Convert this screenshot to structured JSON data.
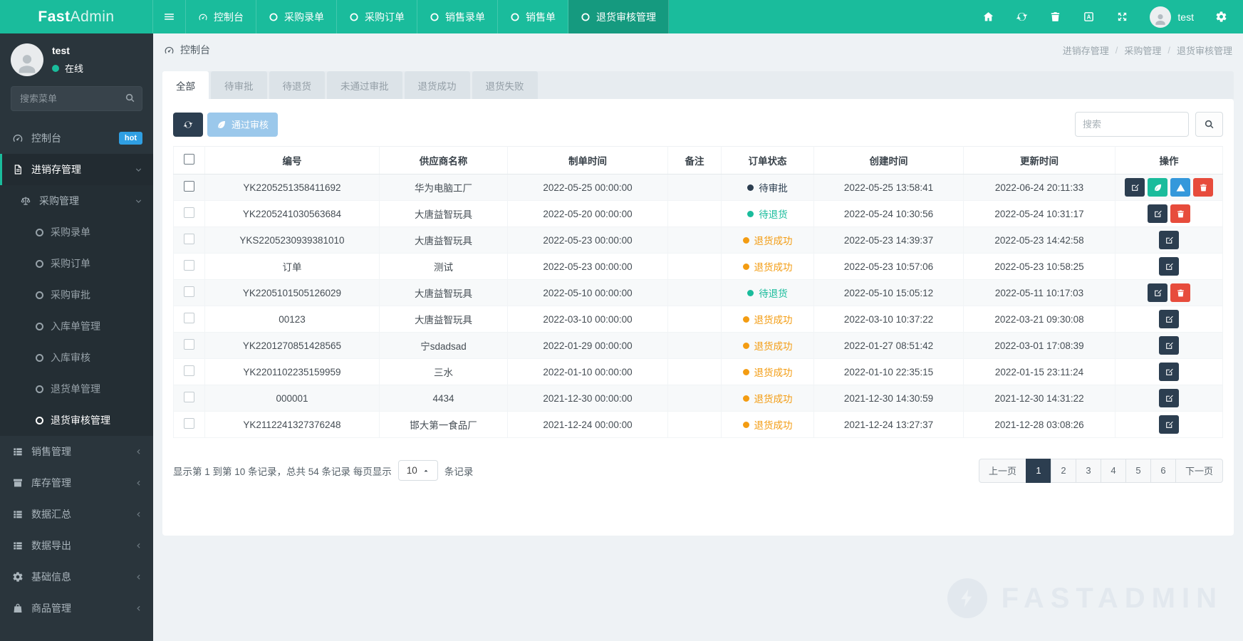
{
  "brand": {
    "bold": "Fast",
    "light": "Admin"
  },
  "colors": {
    "accent": "#1abc9c",
    "dark": "#2c3e50",
    "info": "#3498db",
    "danger": "#e74c3c",
    "warning": "#f39c12",
    "badge": "#2f9fe3"
  },
  "topnav": {
    "items": [
      {
        "key": "console",
        "label": "控制台",
        "icon": "gauge",
        "active": false
      },
      {
        "key": "purchase-entry",
        "label": "采购录单",
        "icon": "circle-o",
        "active": false
      },
      {
        "key": "purchase-order",
        "label": "采购订单",
        "icon": "circle-o",
        "active": false
      },
      {
        "key": "sale-entry",
        "label": "销售录单",
        "icon": "circle-o",
        "active": false
      },
      {
        "key": "sale-order",
        "label": "销售单",
        "icon": "circle-o",
        "active": false
      },
      {
        "key": "return-audit",
        "label": "退货审核管理",
        "icon": "circle-o",
        "active": true
      }
    ],
    "right_icons": [
      {
        "key": "home",
        "icon": "home"
      },
      {
        "key": "refresh",
        "icon": "refresh"
      },
      {
        "key": "trash",
        "icon": "trash"
      },
      {
        "key": "language",
        "icon": "language"
      },
      {
        "key": "fullscreen",
        "icon": "expand"
      }
    ],
    "user": {
      "name": "test"
    }
  },
  "sidebar": {
    "user": {
      "name": "test",
      "status": "在线"
    },
    "search_placeholder": "搜索菜单",
    "menu": [
      {
        "key": "console",
        "label": "控制台",
        "icon": "gauge",
        "badge": "hot"
      },
      {
        "key": "jxc",
        "label": "进销存管理",
        "icon": "file-text",
        "chevron": "down",
        "active": true,
        "children": [
          {
            "key": "purchase",
            "label": "采购管理",
            "icon": "scale",
            "chevron": "down",
            "children": [
              {
                "key": "purchase-entry",
                "label": "采购录单"
              },
              {
                "key": "purchase-order",
                "label": "采购订单"
              },
              {
                "key": "purchase-approve",
                "label": "采购审批"
              },
              {
                "key": "stockin-manage",
                "label": "入库单管理"
              },
              {
                "key": "stockin-audit",
                "label": "入库审核"
              },
              {
                "key": "return-manage",
                "label": "退货单管理"
              },
              {
                "key": "return-audit",
                "label": "退货审核管理",
                "active": true
              }
            ]
          }
        ]
      },
      {
        "key": "sale",
        "label": "销售管理",
        "icon": "list",
        "chevron": "left"
      },
      {
        "key": "stock",
        "label": "库存管理",
        "icon": "archive",
        "chevron": "left"
      },
      {
        "key": "data-summary",
        "label": "数据汇总",
        "icon": "list",
        "chevron": "left"
      },
      {
        "key": "data-export",
        "label": "数据导出",
        "icon": "list",
        "chevron": "left"
      },
      {
        "key": "base-info",
        "label": "基础信息",
        "icon": "cogs",
        "chevron": "left"
      },
      {
        "key": "goods",
        "label": "商品管理",
        "icon": "bag",
        "chevron": "left"
      }
    ]
  },
  "header": {
    "title": "控制台",
    "breadcrumb": [
      "进销存管理",
      "采购管理",
      "退货审核管理"
    ]
  },
  "tabs": [
    {
      "label": "全部",
      "active": true
    },
    {
      "label": "待审批",
      "active": false
    },
    {
      "label": "待退货",
      "active": false
    },
    {
      "label": "未通过审批",
      "active": false
    },
    {
      "label": "退货成功",
      "active": false
    },
    {
      "label": "退货失败",
      "active": false
    }
  ],
  "toolbar": {
    "approve_label": "通过审核",
    "search_placeholder": "搜索"
  },
  "table": {
    "columns": [
      "编号",
      "供应商名称",
      "制单时间",
      "备注",
      "订单状态",
      "创建时间",
      "更新时间",
      "操作"
    ],
    "action_styles": {
      "edit": {
        "icon": "edit",
        "color": "#2c3e50"
      },
      "leaf": {
        "icon": "leaf",
        "color": "#1abc9c"
      },
      "warn": {
        "icon": "warn",
        "color": "#3498db"
      },
      "trash": {
        "icon": "trash",
        "color": "#e74c3c"
      }
    },
    "rows": [
      {
        "id": "YK2205251358411692",
        "supplier": "华为电脑工厂",
        "order_time": "2022-05-25 00:00:00",
        "remark": "",
        "status": {
          "label": "待审批",
          "color": "#2c3e50"
        },
        "created": "2022-05-25 13:58:41",
        "updated": "2022-06-24 20:11:33",
        "actions": [
          "edit",
          "leaf",
          "warn",
          "trash"
        ]
      },
      {
        "id": "YK2205241030563684",
        "supplier": "大唐益智玩具",
        "order_time": "2022-05-20 00:00:00",
        "remark": "",
        "status": {
          "label": "待退货",
          "color": "#1abc9c"
        },
        "created": "2022-05-24 10:30:56",
        "updated": "2022-05-24 10:31:17",
        "actions": [
          "edit",
          "trash"
        ]
      },
      {
        "id": "YKS2205230939381010",
        "supplier": "大唐益智玩具",
        "order_time": "2022-05-23 00:00:00",
        "remark": "",
        "status": {
          "label": "退货成功",
          "color": "#f39c12"
        },
        "created": "2022-05-23 14:39:37",
        "updated": "2022-05-23 14:42:58",
        "actions": [
          "edit"
        ]
      },
      {
        "id": "订单",
        "supplier": "测试",
        "order_time": "2022-05-23 00:00:00",
        "remark": "",
        "status": {
          "label": "退货成功",
          "color": "#f39c12"
        },
        "created": "2022-05-23 10:57:06",
        "updated": "2022-05-23 10:58:25",
        "actions": [
          "edit"
        ]
      },
      {
        "id": "YK2205101505126029",
        "supplier": "大唐益智玩具",
        "order_time": "2022-05-10 00:00:00",
        "remark": "",
        "status": {
          "label": "待退货",
          "color": "#1abc9c"
        },
        "created": "2022-05-10 15:05:12",
        "updated": "2022-05-11 10:17:03",
        "actions": [
          "edit",
          "trash"
        ]
      },
      {
        "id": "00123",
        "supplier": "大唐益智玩具",
        "order_time": "2022-03-10 00:00:00",
        "remark": "",
        "status": {
          "label": "退货成功",
          "color": "#f39c12"
        },
        "created": "2022-03-10 10:37:22",
        "updated": "2022-03-21 09:30:08",
        "actions": [
          "edit"
        ]
      },
      {
        "id": "YK2201270851428565",
        "supplier": "宁sdadsad",
        "order_time": "2022-01-29 00:00:00",
        "remark": "",
        "status": {
          "label": "退货成功",
          "color": "#f39c12"
        },
        "created": "2022-01-27 08:51:42",
        "updated": "2022-03-01 17:08:39",
        "actions": [
          "edit"
        ]
      },
      {
        "id": "YK2201102235159959",
        "supplier": "三水",
        "order_time": "2022-01-10 00:00:00",
        "remark": "",
        "status": {
          "label": "退货成功",
          "color": "#f39c12"
        },
        "created": "2022-01-10 22:35:15",
        "updated": "2022-01-15 23:11:24",
        "actions": [
          "edit"
        ]
      },
      {
        "id": "000001",
        "supplier": "4434",
        "order_time": "2021-12-30 00:00:00",
        "remark": "",
        "status": {
          "label": "退货成功",
          "color": "#f39c12"
        },
        "created": "2021-12-30 14:30:59",
        "updated": "2021-12-30 14:31:22",
        "actions": [
          "edit"
        ]
      },
      {
        "id": "YK2112241327376248",
        "supplier": "邯大第一食品厂",
        "order_time": "2021-12-24 00:00:00",
        "remark": "",
        "status": {
          "label": "退货成功",
          "color": "#f39c12"
        },
        "created": "2021-12-24 13:27:37",
        "updated": "2021-12-28 03:08:26",
        "actions": [
          "edit"
        ]
      }
    ]
  },
  "footer": {
    "summary_prefix": "显示第 1 到第 10 条记录，总共 54 条记录 每页显示",
    "page_size": "10",
    "summary_suffix": "条记录",
    "pagination": {
      "prev": "上一页",
      "next": "下一页",
      "pages": [
        "1",
        "2",
        "3",
        "4",
        "5",
        "6"
      ],
      "active": "1"
    }
  },
  "watermark": {
    "text": "FASTADMIN"
  }
}
